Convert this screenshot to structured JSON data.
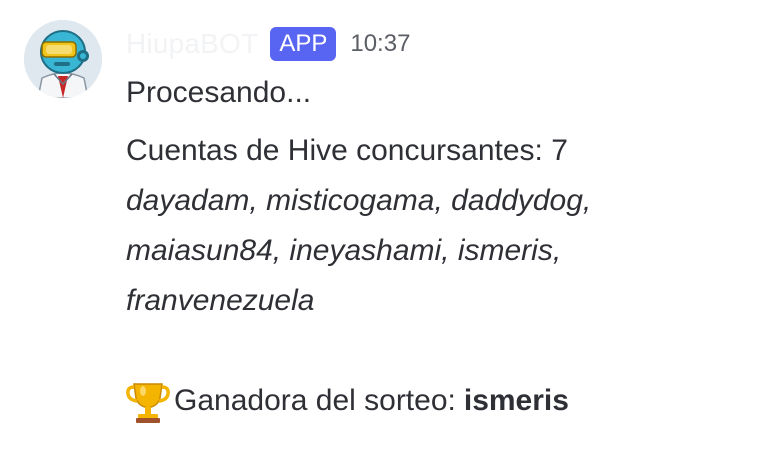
{
  "message": {
    "author": {
      "name": "HiupaBOT",
      "badge": "APP"
    },
    "timestamp": "10:37",
    "lines": {
      "processing": "Procesando...",
      "count_label": "Cuentas de Hive concursantes: 7",
      "accounts_line_1": "dayadam, misticogama, daddydog,",
      "accounts_line_2": "maiasun84, ineyashami, ismeris,",
      "accounts_line_3": "franvenezuela",
      "winner_label": "Ganadora del sorteo:",
      "winner_name": "ismeris"
    },
    "icons": {
      "avatar": "robot-avatar",
      "trophy": "trophy-icon"
    },
    "colors": {
      "badge_bg": "#5865f2",
      "text": "#2e3035",
      "timestamp": "#5c5e66",
      "trophy_gold": "#f4b400"
    }
  }
}
